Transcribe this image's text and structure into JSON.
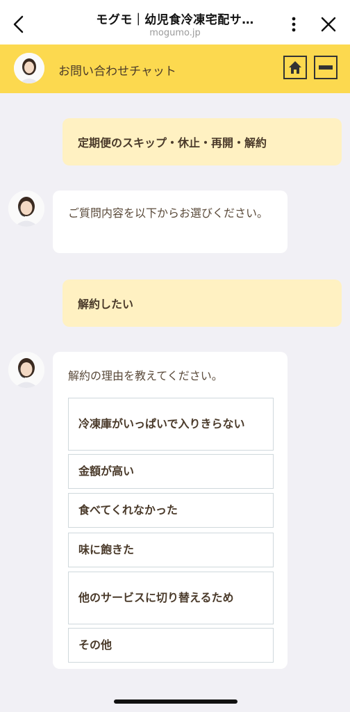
{
  "browser": {
    "title": "モグモ｜幼児食冷凍宅配サ…",
    "url": "mogumo.jp",
    "icons": [
      "back-chevron-icon",
      "more-vertical-icon",
      "close-icon"
    ]
  },
  "chat_header": {
    "title": "お問い合わせチャット",
    "icons": [
      "operator-avatar",
      "home-icon",
      "minimize-icon"
    ],
    "accent_color": "#fcd94f"
  },
  "messages": [
    {
      "from": "user",
      "text": "定期便のスキップ・休止・再開・解約"
    },
    {
      "from": "bot",
      "text": "ご質問内容を以下からお選びください。"
    },
    {
      "from": "user",
      "text": "解約したい"
    },
    {
      "from": "bot",
      "text": "解約の理由を教えてください。",
      "options": [
        "冷凍庫がいっぱいで入りきらない",
        "金額が高い",
        "食べてくれなかった",
        "味に飽きた",
        "他のサービスに切り替えるため",
        "その他"
      ]
    }
  ],
  "colors": {
    "user_bubble": "#fff1c2",
    "bot_bubble": "#ffffff",
    "background": "#f1f0f5"
  }
}
